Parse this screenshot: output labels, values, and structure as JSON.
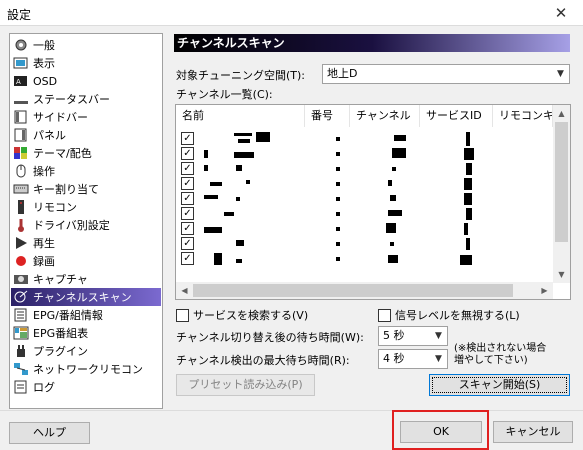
{
  "window": {
    "title": "設定",
    "close_glyph": "✕"
  },
  "sidebar": {
    "items": [
      {
        "label": "一般",
        "icon": "gear-icon"
      },
      {
        "label": "表示",
        "icon": "display-icon"
      },
      {
        "label": "OSD",
        "icon": "osd-icon"
      },
      {
        "label": "ステータスバー",
        "icon": "statusbar-icon"
      },
      {
        "label": "サイドバー",
        "icon": "sidebar-icon"
      },
      {
        "label": "パネル",
        "icon": "panel-icon"
      },
      {
        "label": "テーマ/配色",
        "icon": "palette-icon"
      },
      {
        "label": "操作",
        "icon": "mouse-icon"
      },
      {
        "label": "キー割り当て",
        "icon": "keyboard-icon"
      },
      {
        "label": "リモコン",
        "icon": "remote-icon"
      },
      {
        "label": "ドライバ別設定",
        "icon": "driver-icon"
      },
      {
        "label": "再生",
        "icon": "play-icon"
      },
      {
        "label": "録画",
        "icon": "record-icon"
      },
      {
        "label": "キャプチャ",
        "icon": "camera-icon"
      },
      {
        "label": "チャンネルスキャン",
        "icon": "antenna-icon",
        "selected": true
      },
      {
        "label": "EPG/番組情報",
        "icon": "epg-icon"
      },
      {
        "label": "EPG番組表",
        "icon": "program-guide-icon"
      },
      {
        "label": "プラグイン",
        "icon": "plugin-icon"
      },
      {
        "label": "ネットワークリモコン",
        "icon": "network-icon"
      },
      {
        "label": "ログ",
        "icon": "log-icon"
      }
    ]
  },
  "panel": {
    "title": "チャンネルスキャン",
    "tuning_space_label": "対象チューニング空間(T):",
    "tuning_space_value": "地上D",
    "channel_list_label": "チャンネル一覧(C):",
    "columns": [
      "名前",
      "番号",
      "チャンネル",
      "サービスID",
      "リモコンキ"
    ],
    "rows_checked": [
      true,
      true,
      true,
      true,
      true,
      true,
      true,
      true,
      true
    ],
    "search_services_label": "サービスを検索する(V)",
    "search_services_checked": true,
    "ignore_signal_label": "信号レベルを無視する(L)",
    "ignore_signal_checked": false,
    "wait_after_switch_label": "チャンネル切り替え後の待ち時間(W):",
    "wait_after_switch_value": "5 秒",
    "max_detect_wait_label": "チャンネル検出の最大待ち時間(R):",
    "max_detect_wait_value": "4 秒",
    "note": "(※検出されない場合\n増やして下さい)",
    "preset_button": "プリセット読み込み(P)",
    "scan_button": "スキャン開始(S)"
  },
  "footer": {
    "help_button": "ヘルプ",
    "ok_button": "OK",
    "cancel_button": "キャンセル"
  },
  "colors": {
    "highlight": "#e02020",
    "selection_start": "#2b2166",
    "selection_end": "#7b6ad0"
  }
}
